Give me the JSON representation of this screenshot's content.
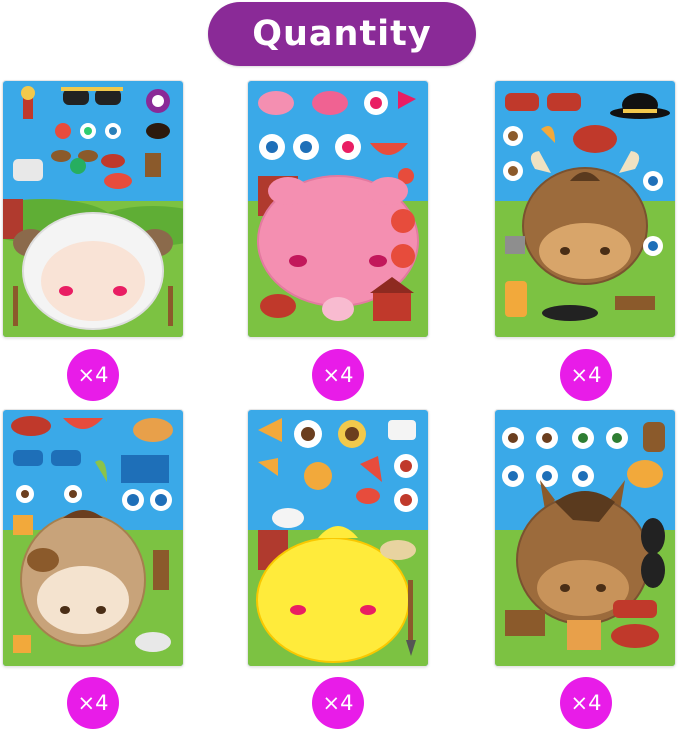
{
  "title": "Quantity",
  "colors": {
    "title_bg": "#8a2a97",
    "badge_bg": "#e81ce8",
    "sky": "#3aa9e8",
    "grass": "#7cc242"
  },
  "sheets": [
    {
      "animal": "sheep",
      "quantity_label": "×4"
    },
    {
      "animal": "pig",
      "quantity_label": "×4"
    },
    {
      "animal": "bull",
      "quantity_label": "×4"
    },
    {
      "animal": "cow",
      "quantity_label": "×4"
    },
    {
      "animal": "chick",
      "quantity_label": "×4"
    },
    {
      "animal": "horse",
      "quantity_label": "×4"
    }
  ]
}
